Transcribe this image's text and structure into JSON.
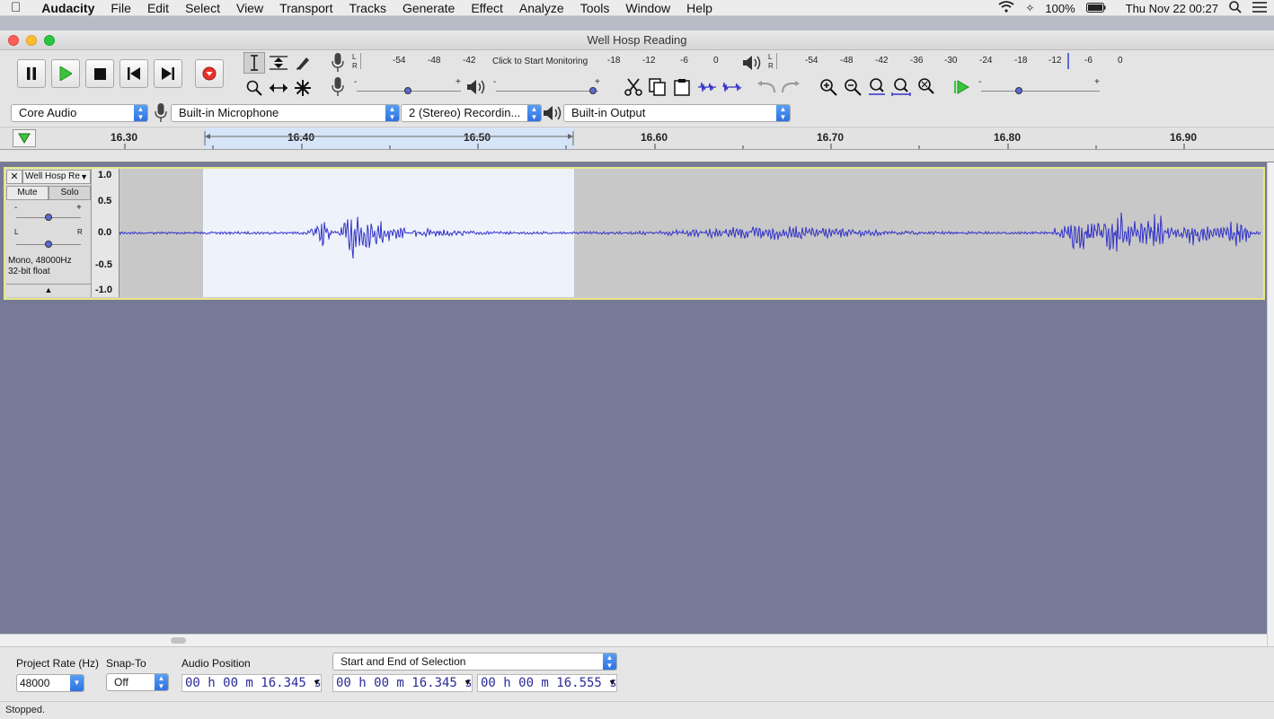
{
  "menubar": {
    "app": "Audacity",
    "items": [
      "File",
      "Edit",
      "Select",
      "View",
      "Transport",
      "Tracks",
      "Generate",
      "Effect",
      "Analyze",
      "Tools",
      "Window",
      "Help"
    ],
    "battery": "100%",
    "clock": "Thu Nov 22  00:27"
  },
  "window": {
    "title": "Well Hosp Reading"
  },
  "transport": {
    "buttons": [
      "pause",
      "play",
      "stop",
      "skip-to-start",
      "skip-to-end",
      "record"
    ]
  },
  "meters": {
    "record_scale": [
      "-54",
      "-48",
      "-42",
      "-18",
      "-12",
      "-6",
      "0"
    ],
    "record_monitor_text": "Click to Start Monitoring",
    "play_scale": [
      "-54",
      "-48",
      "-42",
      "-36",
      "-30",
      "-24",
      "-18",
      "-12",
      "-6",
      "0"
    ],
    "channel_left": "L",
    "channel_right": "R"
  },
  "devices": {
    "host": "Core Audio",
    "input": "Built-in Microphone",
    "channels": "2 (Stereo) Recordin...",
    "output": "Built-in Output"
  },
  "ruler": {
    "ticks": [
      "16.30",
      "16.40",
      "16.50",
      "16.60",
      "16.70",
      "16.80",
      "16.90"
    ]
  },
  "track": {
    "name": "Well Hosp Re",
    "mute_label": "Mute",
    "solo_label": "Solo",
    "gain_minus": "-",
    "gain_plus": "+",
    "pan_left": "L",
    "pan_right": "R",
    "info_line1": "Mono, 48000Hz",
    "info_line2": "32-bit float",
    "scale": [
      "1.0",
      "0.5",
      "0.0",
      "-0.5",
      "-1.0"
    ],
    "wave_color": "#3232c8"
  },
  "selection_bar": {
    "rate_label": "Project Rate (Hz)",
    "rate_value": "48000",
    "snap_label": "Snap-To",
    "snap_value": "Off",
    "position_label": "Audio Position",
    "position_value": "00 h 00 m 16.345 s",
    "selection_mode": "Start and End of Selection",
    "selection_start": "00 h 00 m 16.345 s",
    "selection_end": "00 h 00 m 16.555 s"
  },
  "status": {
    "text": "Stopped."
  }
}
